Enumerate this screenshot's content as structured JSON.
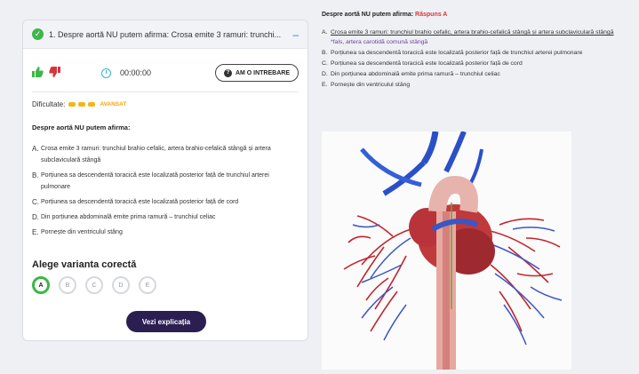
{
  "question": {
    "number": "1.",
    "header_text": "Despre aortă NU putem afirma: Crosa emite 3 ramuri: trunchi...",
    "timer": "00:00:00",
    "ask_label": "AM O INTREBARE",
    "difficulty_label": "Dificultate:",
    "difficulty_level": "AVANSAT",
    "title": "Despre aortă NU putem afirma:",
    "options": [
      {
        "letter": "A.",
        "text": "Crosa emite 3 ramuri: trunchiul brahio cefalic, artera brahio-cefalică stângă și artera subclaviculară stângă"
      },
      {
        "letter": "B.",
        "text": "Porțiunea sa descendentă toracică este localizată posterior față de trunchiul arterei pulmonare"
      },
      {
        "letter": "C.",
        "text": "Porțiunea sa descendentă toracică este localizată posterior față de cord"
      },
      {
        "letter": "D.",
        "text": "Din porțiunea abdominală emite prima ramură – trunchiul celiac"
      },
      {
        "letter": "E.",
        "text": "Pornește din ventriculul stâng"
      }
    ],
    "choose_label": "Alege varianta corectă",
    "choices": [
      "A",
      "B",
      "C",
      "D",
      "E"
    ],
    "explain_label": "Vezi explicația"
  },
  "answer_panel": {
    "title": "Despre aortă NU putem afirma:",
    "answer": "Răspuns A",
    "optA_letter": "A.",
    "optA_underlined": "Crosa emite 3 ramuri: trunchiul brahio cefalic, artera brahio-cefalică stângă și artera subclaviculară stângă",
    "optA_note": " *fals, artera carotidă comună stângă",
    "options": [
      {
        "letter": "B.",
        "text": "Porțiunea sa descendentă toracică este localizată posterior față de trunchiul arterei pulmonare"
      },
      {
        "letter": "C.",
        "text": "Porțiunea sa descendentă toracică este localizată posterior față de cord"
      },
      {
        "letter": "D.",
        "text": "Din porțiunea abdominală emite prima ramură – trunchiul celiac"
      },
      {
        "letter": "E.",
        "text": "Pornește din ventriculul stâng"
      }
    ]
  },
  "colors": {
    "accent_green": "#3db64a",
    "accent_red": "#d9343a",
    "button_dark": "#2b1f52",
    "difficulty": "#f3b51b"
  }
}
